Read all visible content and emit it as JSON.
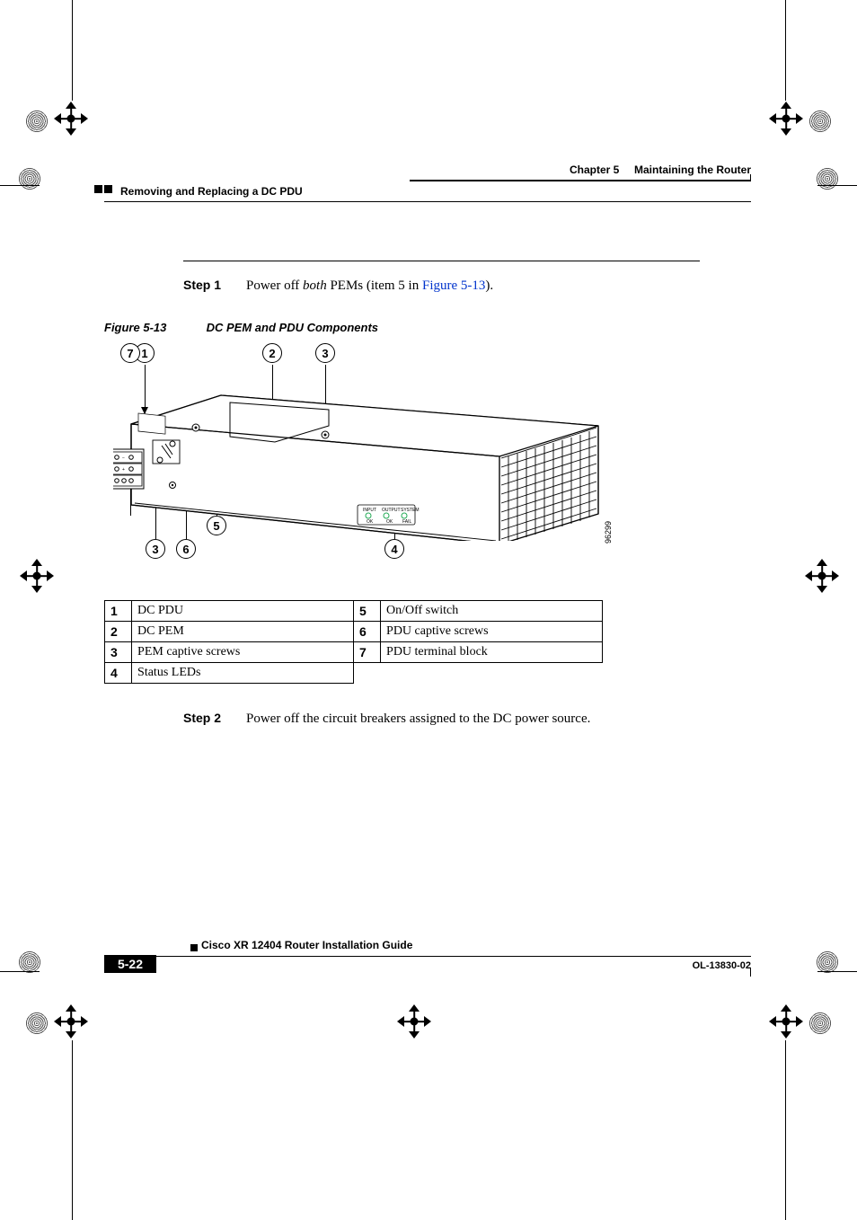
{
  "header": {
    "chapter_label": "Chapter 5",
    "chapter_title": "Maintaining the Router",
    "section": "Removing and Replacing a DC PDU"
  },
  "step1": {
    "label": "Step 1",
    "text_prefix": "Power off ",
    "text_em": "both",
    "text_mid": " PEMs (item 5 in ",
    "link": "Figure 5-13",
    "text_suffix": ")."
  },
  "figure": {
    "number": "Figure 5-13",
    "title": "DC PEM and PDU Components",
    "graphic_id": "96299",
    "callouts_top": [
      "1",
      "2",
      "3"
    ],
    "callouts_bottom_left": [
      "7",
      "3",
      "5",
      "6"
    ],
    "callouts_bottom_right": [
      "4"
    ],
    "panel_small_text": [
      "INPUT",
      "OUTPUT",
      "SYSTEM",
      "OK",
      "OK",
      "FAIL"
    ]
  },
  "legend": [
    {
      "n": "1",
      "d": "DC PDU",
      "n2": "5",
      "d2": "On/Off switch"
    },
    {
      "n": "2",
      "d": "DC PEM",
      "n2": "6",
      "d2": "PDU captive screws"
    },
    {
      "n": "3",
      "d": "PEM captive screws",
      "n2": "7",
      "d2": "PDU terminal block"
    },
    {
      "n": "4",
      "d": "Status LEDs",
      "n2": "",
      "d2": ""
    }
  ],
  "step2": {
    "label": "Step 2",
    "text": "Power off the circuit breakers assigned to the DC power source."
  },
  "footer": {
    "guide": "Cisco XR 12404 Router Installation Guide",
    "page": "5-22",
    "doc_id": "OL-13830-02"
  }
}
